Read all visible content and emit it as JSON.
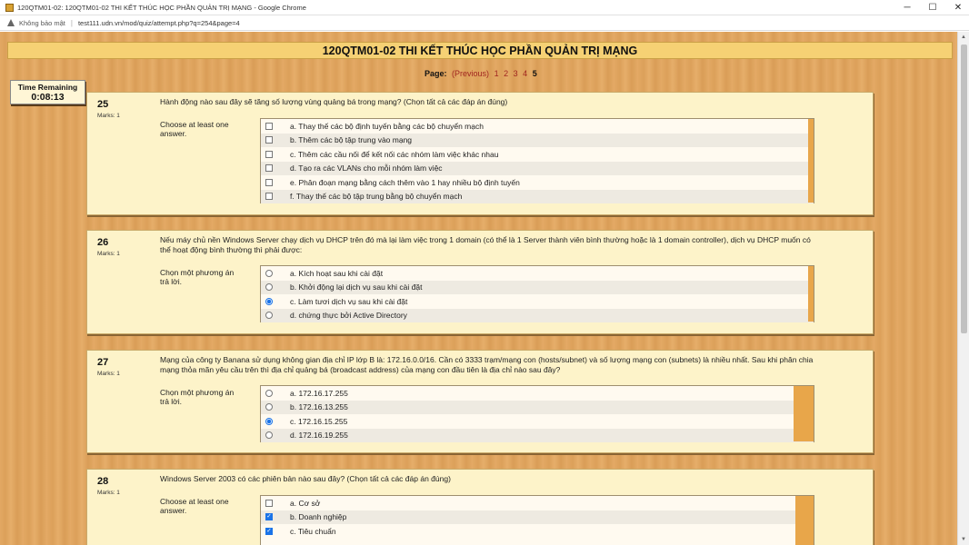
{
  "window": {
    "title": "120QTM01-02: 120QTM01-02 THI KẾT THÚC HỌC PHẦN QUẢN TRỊ MẠNG - Google Chrome",
    "controls": {
      "minimize": "─",
      "maximize": "☐",
      "close": "✕"
    }
  },
  "address_bar": {
    "security_label": "Không bảo mật",
    "url": "test111.udn.vn/mod/quiz/attempt.php?q=254&page=4"
  },
  "quiz": {
    "title": "120QTM01-02 THI KẾT THÚC HỌC PHẦN QUẢN TRỊ MẠNG",
    "pagination": {
      "label": "Page:",
      "previous": "(Previous)",
      "pages": [
        "1",
        "2",
        "3",
        "4"
      ],
      "current": "5"
    },
    "timer": {
      "label": "Time Remaining",
      "value": "0:08:13"
    },
    "questions": [
      {
        "number": "25",
        "marks": "Marks: 1",
        "text": "Hành động nào sau đây sẽ tăng số lượng vùng quảng bá trong mạng? (Chọn tất cả các đáp án đúng)",
        "prompt": "Choose at least one answer.",
        "type": "checkbox",
        "options": [
          {
            "label": "a. Thay thế các bộ định tuyến bằng các bộ chuyển mạch",
            "checked": false
          },
          {
            "label": "b. Thêm các bộ tập trung vào mạng",
            "checked": false
          },
          {
            "label": "c. Thêm các cầu nối để kết nối các nhóm làm việc khác nhau",
            "checked": false
          },
          {
            "label": "d. Tạo ra các VLANs cho mỗi nhóm làm việc",
            "checked": false
          },
          {
            "label": "e. Phân đoạn mạng bằng cách thêm vào 1 hay nhiều bộ định tuyến",
            "checked": false
          },
          {
            "label": "f. Thay thế các bộ tập trung bằng bộ chuyển mạch",
            "checked": false
          }
        ]
      },
      {
        "number": "26",
        "marks": "Marks: 1",
        "text": "Nếu máy chủ nền Windows Server chạy dịch vụ DHCP trên đó mà lại làm việc trong 1 domain (có thể là 1 Server thành viên bình thường hoặc là 1 domain controller), dịch vụ DHCP muốn có thể hoạt động bình thường thì phải được:",
        "prompt": "Chọn một phương án trả lời.",
        "type": "radio",
        "options": [
          {
            "label": "a. Kích hoạt sau khi cài đặt",
            "checked": false
          },
          {
            "label": "b. Khởi động lại dịch vụ sau khi cài đặt",
            "checked": false
          },
          {
            "label": "c. Làm tươi dịch vụ sau khi cài đặt",
            "checked": true
          },
          {
            "label": "d. chứng thực bởi Active Directory",
            "checked": false
          }
        ]
      },
      {
        "number": "27",
        "marks": "Marks: 1",
        "text": "Mạng của công ty Banana sử dụng không gian địa chỉ IP lớp B là: 172.16.0.0/16. Cần có 3333 trạm/mạng con (hosts/subnet) và số lượng mạng con (subnets) là nhiều nhất. Sau khi phân chia mạng thỏa mãn yêu cầu trên thì địa chỉ quảng bá (broadcast address) của mạng con đầu tiên là địa chỉ nào sau đây?",
        "prompt": "Chọn một phương án trả lời.",
        "type": "radio",
        "options": [
          {
            "label": "a. 172.16.17.255",
            "checked": false
          },
          {
            "label": "b. 172.16.13.255",
            "checked": false
          },
          {
            "label": "c. 172.16.15.255",
            "checked": true
          },
          {
            "label": "d. 172.16.19.255",
            "checked": false
          }
        ]
      },
      {
        "number": "28",
        "marks": "Marks: 1",
        "text": "Windows Server 2003 có các phiên bản nào sau đây? (Chọn tất cả các đáp án đúng)",
        "prompt": "Choose at least one answer.",
        "type": "checkbox",
        "options": [
          {
            "label": "a. Cơ sở",
            "checked": false
          },
          {
            "label": "b. Doanh nghiệp",
            "checked": true
          },
          {
            "label": "c. Tiêu chuẩn",
            "checked": true
          }
        ]
      }
    ]
  },
  "colors": {
    "banner_bg": "#f6d174",
    "question_bg": "#fdf3c9",
    "link_red": "#a0251f",
    "selected_blue": "#1a73e8"
  }
}
